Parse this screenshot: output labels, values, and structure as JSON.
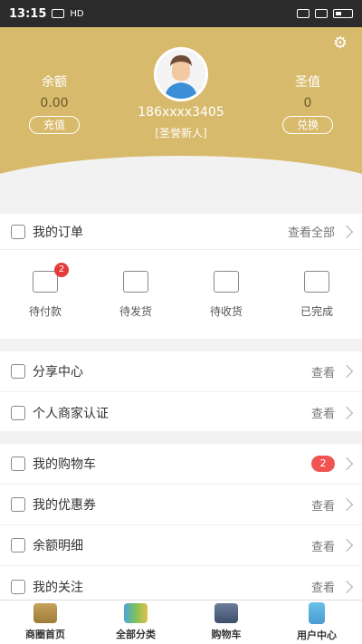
{
  "status_bar": {
    "time": "13:15",
    "signal_text": "HD"
  },
  "header": {
    "balance_label": "余额",
    "balance_value": "0.00",
    "recharge_label": "充值",
    "points_label": "圣值",
    "points_value": "0",
    "exchange_label": "兑换",
    "phone": "186xxxx3405",
    "level": "[圣誉新人]"
  },
  "orders": {
    "title": "我的订单",
    "view_all": "查看全部",
    "items": [
      {
        "label": "待付款",
        "icon": "wallet-icon",
        "badge": "2"
      },
      {
        "label": "待发货",
        "icon": "box-icon"
      },
      {
        "label": "待收货",
        "icon": "truck-icon"
      },
      {
        "label": "已完成",
        "icon": "plug-icon"
      }
    ]
  },
  "share": {
    "rows": [
      {
        "label": "分享中心",
        "action": "查看",
        "icon": "share-icon"
      },
      {
        "label": "个人商家认证",
        "action": "查看",
        "icon": "clipboard-icon"
      }
    ]
  },
  "cart": {
    "rows": [
      {
        "label": "我的购物车",
        "badge": "2",
        "icon": "cart-icon"
      },
      {
        "label": "我的优惠券",
        "action": "查看",
        "icon": "coupon-icon"
      },
      {
        "label": "余额明细",
        "action": "查看",
        "icon": "moneybag-icon"
      },
      {
        "label": "我的关注",
        "action": "查看",
        "icon": "star-icon"
      }
    ]
  },
  "tabbar": {
    "items": [
      {
        "label": "商圈首页",
        "icon": "shop-icon"
      },
      {
        "label": "全部分类",
        "icon": "puzzle-icon"
      },
      {
        "label": "购物车",
        "icon": "basket-icon"
      },
      {
        "label": "用户中心",
        "icon": "medal-icon"
      }
    ]
  },
  "colors": {
    "header": "#d8ba6c",
    "badge": "#e63a3a"
  }
}
